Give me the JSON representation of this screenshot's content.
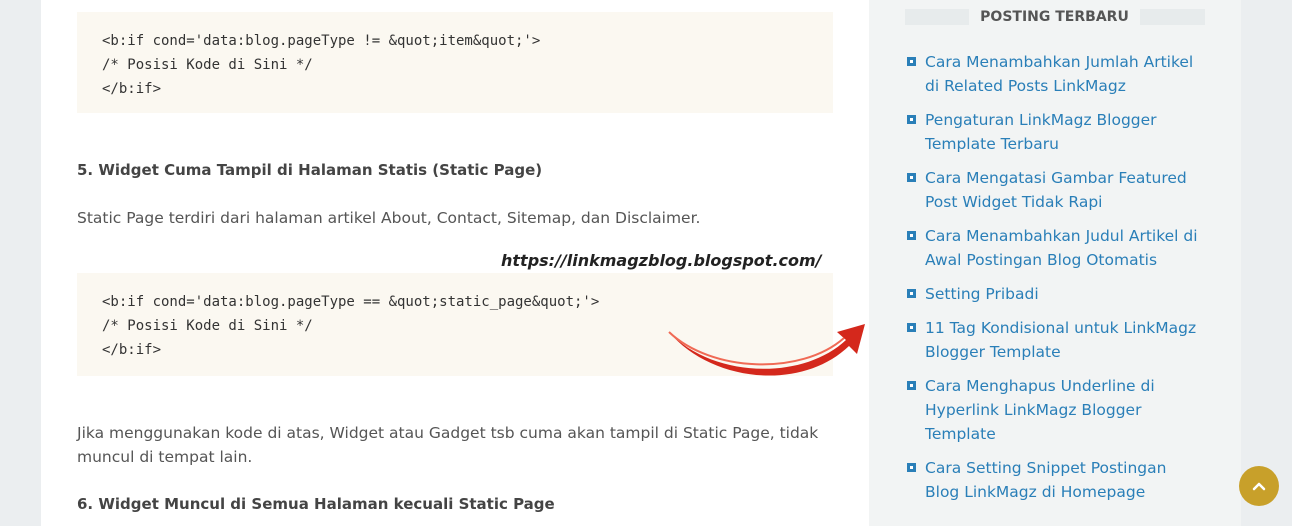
{
  "article": {
    "code1": [
      "<b:if cond='data:blog.pageType != &quot;item&quot;'>",
      "/* Posisi Kode di Sini */",
      "</b:if>"
    ],
    "heading5": "5. Widget Cuma Tampil di Halaman Statis (Static Page)",
    "para_static": "Static Page terdiri dari halaman artikel About, Contact, Sitemap, dan Disclaimer.",
    "watermark": "https://linkmagzblog.blogspot.com/",
    "code2": [
      "<b:if cond='data:blog.pageType == &quot;static_page&quot;'>",
      "/* Posisi Kode di Sini */",
      "</b:if>"
    ],
    "para_usage": "Jika menggunakan kode di atas, Widget atau Gadget tsb cuma akan tampil di Static Page, tidak muncul di tempat lain.",
    "heading6": "6. Widget Muncul di Semua Halaman kecuali Static Page"
  },
  "sidebar": {
    "title": "POSTING TERBARU",
    "posts": [
      "Cara Menambahkan Jumlah Artikel di Related Posts LinkMagz",
      "Pengaturan LinkMagz Blogger Template Terbaru",
      "Cara Mengatasi Gambar Featured Post Widget Tidak Rapi",
      "Cara Menambahkan Judul Artikel di Awal Postingan Blog Otomatis",
      "Setting Pribadi",
      "11 Tag Kondisional untuk LinkMagz Blogger Template",
      "Cara Menghapus Underline di Hyperlink LinkMagz Blogger Template",
      "Cara Setting Snippet Postingan Blog LinkMagz di Homepage"
    ]
  },
  "icons": {
    "arrow": "red-curved-arrow-icon",
    "scroll_top": "chevron-up-icon",
    "bullet": "square-bullet-icon"
  },
  "colors": {
    "link": "#2a7fb8",
    "accent": "#c8a02a",
    "arrow": "#d4281c",
    "code_bg": "#fbf8f1"
  }
}
